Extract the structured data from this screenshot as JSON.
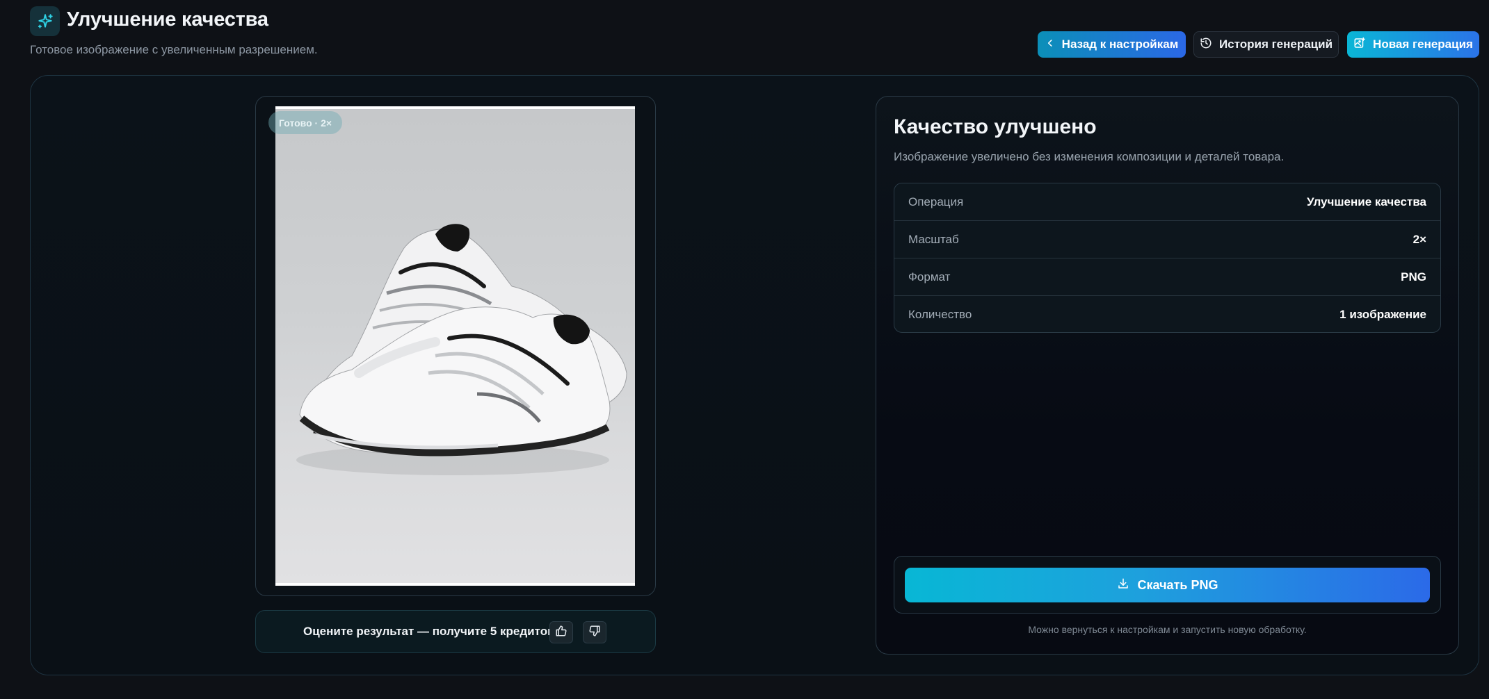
{
  "header": {
    "title": "Улучшение качества",
    "subtitle": "Готовое изображение с увеличенным разрешением.",
    "icon": "sparkles-icon",
    "buttons": {
      "back": "Назад к настройкам",
      "history": "История генераций",
      "new": "Новая генерация"
    }
  },
  "preview": {
    "badge": "Готово · 2×"
  },
  "rating": {
    "text": "Оцените результат — получите 5 кредитов"
  },
  "info": {
    "title": "Качество улучшено",
    "description": "Изображение увеличено без изменения композиции и деталей товара.",
    "specs": [
      {
        "label": "Операция",
        "value": "Улучшение качества"
      },
      {
        "label": "Масштаб",
        "value": "2×"
      },
      {
        "label": "Формат",
        "value": "PNG"
      },
      {
        "label": "Количество",
        "value": "1 изображение"
      }
    ],
    "download_label": "Скачать PNG",
    "footnote": "Можно вернуться к настройкам и запустить новую обработку."
  },
  "colors": {
    "accent_start": "#0ab6d6",
    "accent_end": "#2b6ae8",
    "background": "#0e1116"
  }
}
